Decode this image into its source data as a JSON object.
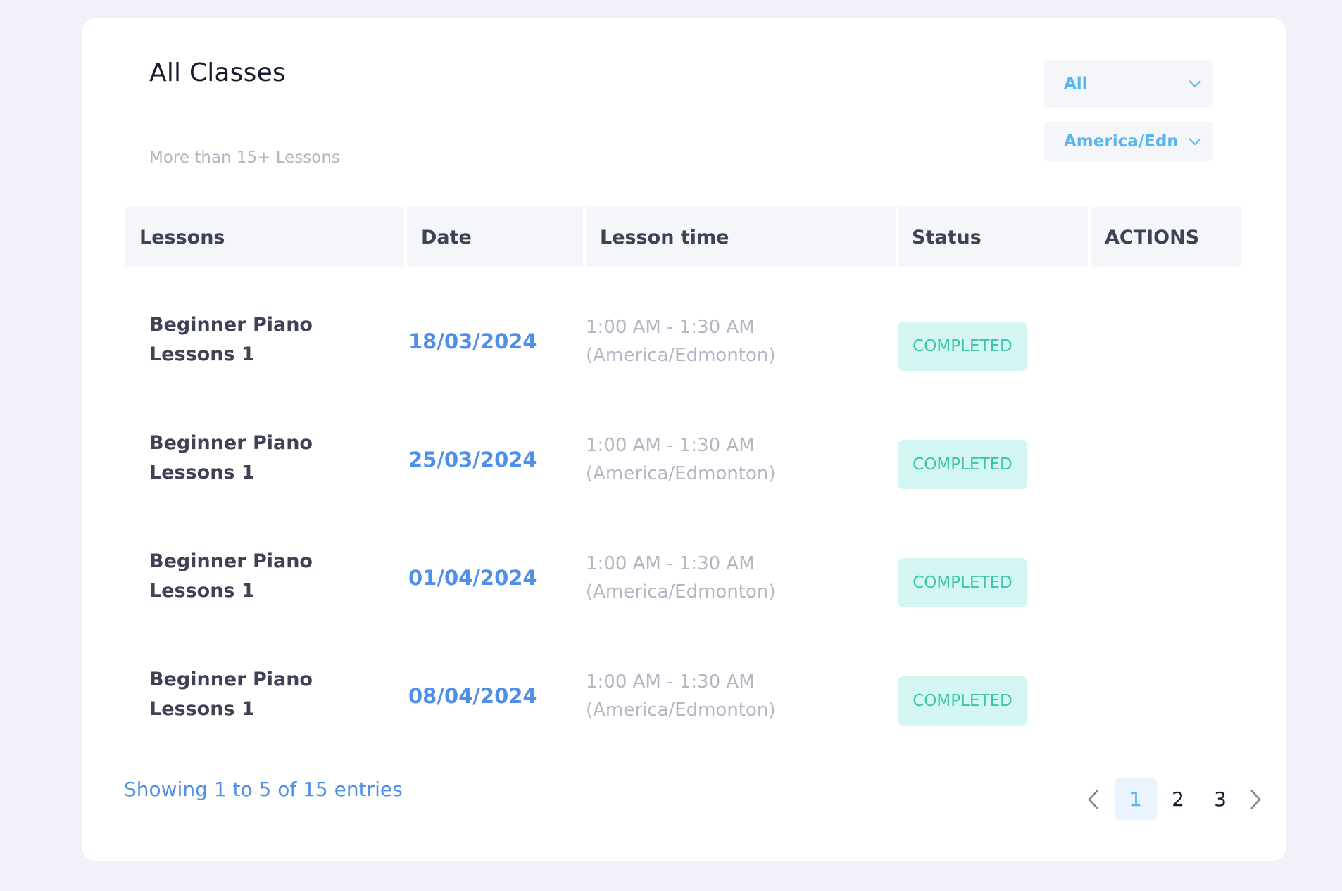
{
  "header": {
    "title": "All Classes",
    "subtitle": "More than 15+ Lessons"
  },
  "filters": {
    "status_select": "All",
    "timezone_select": "America/Edmonton"
  },
  "table": {
    "columns": [
      "Lessons",
      "Date",
      "Lesson time",
      "Status",
      "ACTIONS"
    ],
    "rows": [
      {
        "lesson_line1": "Beginner Piano",
        "lesson_line2": "Lessons 1",
        "date": "18/03/2024",
        "time_line1": "1:00 AM - 1:30 AM",
        "time_line2": "(America/Edmonton)",
        "status": "COMPLETED"
      },
      {
        "lesson_line1": "Beginner Piano",
        "lesson_line2": "Lessons 1",
        "date": "25/03/2024",
        "time_line1": "1:00 AM - 1:30 AM",
        "time_line2": "(America/Edmonton)",
        "status": "COMPLETED"
      },
      {
        "lesson_line1": "Beginner Piano",
        "lesson_line2": "Lessons 1",
        "date": "01/04/2024",
        "time_line1": "1:00 AM - 1:30 AM",
        "time_line2": "(America/Edmonton)",
        "status": "COMPLETED"
      },
      {
        "lesson_line1": "Beginner Piano",
        "lesson_line2": "Lessons 1",
        "date": "08/04/2024",
        "time_line1": "1:00 AM - 1:30 AM",
        "time_line2": "(America/Edmonton)",
        "status": "COMPLETED"
      }
    ]
  },
  "footer": {
    "showing": "Showing 1 to 5 of 15 entries",
    "pages": [
      "1",
      "2",
      "3"
    ],
    "active_page": "1"
  },
  "icons": {
    "select_arrow": "chevron-down-icon",
    "prev": "chevron-left-icon",
    "next": "chevron-right-icon"
  },
  "colors": {
    "accent_blue": "#4f8fea",
    "select_text": "#55b7ee",
    "badge_bg": "#d4f6f2",
    "badge_text": "#3dc3aa"
  }
}
